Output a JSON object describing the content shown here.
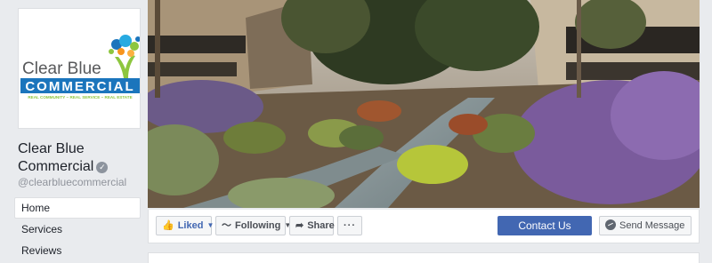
{
  "page": {
    "name": "Clear Blue Commercial",
    "handle": "@clearbluecommercial"
  },
  "logo": {
    "word1": "Clear Blue",
    "word2": "COMMERCIAL",
    "tagline": "REAL COMMUNITY ~ REAL SERVICE ~ REAL ESTATE"
  },
  "nav": {
    "items": [
      {
        "label": "Home"
      },
      {
        "label": "Services"
      },
      {
        "label": "Reviews"
      }
    ]
  },
  "actions": {
    "liked": "Liked",
    "following": "Following",
    "share": "Share",
    "more": "···",
    "contact": "Contact Us",
    "message": "Send Message"
  },
  "colors": {
    "fb_blue": "#4267b2",
    "logo_blue": "#1b75bc",
    "logo_green": "#8dc63f"
  },
  "icons": {
    "verified": "verified-badge-icon",
    "liked": "thumbs-up-icon",
    "following": "rss-icon",
    "share": "share-arrow-icon",
    "message": "messenger-icon"
  }
}
